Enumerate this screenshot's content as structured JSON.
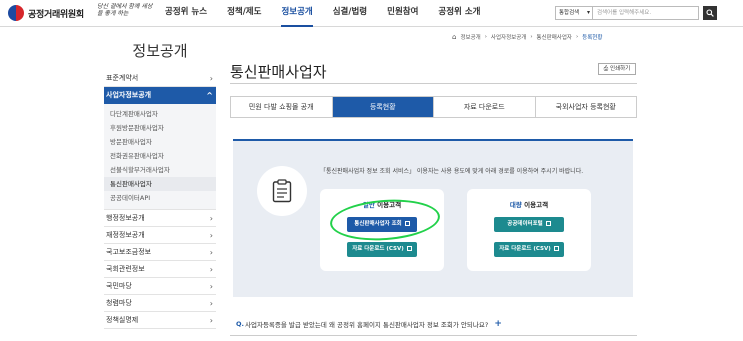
{
  "header": {
    "logo_text": "공정거래위원회",
    "slogan": "당신 곁에서 함께 세상을 좋게 하는",
    "nav": [
      "공정위 뉴스",
      "정책/제도",
      "정보공개",
      "심결/법령",
      "민원참여",
      "공정위 소개"
    ],
    "nav_active_index": 2,
    "search_select": "통합검색",
    "search_placeholder": "검색어를 입력해주세요."
  },
  "sidebar": {
    "title": "정보공개",
    "items_top": [
      {
        "label": "표준계약서",
        "arrow": "›"
      }
    ],
    "active_item": {
      "label": "사업자정보공개",
      "arrow": "^"
    },
    "sub_items": [
      "다단계판매사업자",
      "후원방문판매사업자",
      "방문판매사업자",
      "전화권유판매사업자",
      "선불식할부거래사업자",
      "통신판매사업자",
      "공공데이터API"
    ],
    "sub_active_index": 5,
    "items_bottom": [
      {
        "label": "행정정보공개",
        "arrow": "›"
      },
      {
        "label": "재정정보공개",
        "arrow": "›"
      },
      {
        "label": "국고보조금정보",
        "arrow": "›"
      },
      {
        "label": "국회관련정보",
        "arrow": "›"
      },
      {
        "label": "국민마당",
        "arrow": "›"
      },
      {
        "label": "청렴마당",
        "arrow": "›"
      },
      {
        "label": "정책실명제",
        "arrow": "›"
      }
    ]
  },
  "breadcrumb": [
    "정보공개",
    "사업자정보공개",
    "통신판매사업자",
    "등록현황"
  ],
  "page": {
    "title": "통신판매사업자",
    "print_label": "인쇄하기"
  },
  "tabs": [
    "민원 다발 쇼핑몰 공개",
    "등록현황",
    "자료 다운로드",
    "국외사업자 등록현황"
  ],
  "tab_active_index": 1,
  "panel": {
    "description": "「통신판매사업자 정보 조회 서비스」 이용자는 사용 용도에 맞게 아래 경로를 이용하여 주시기 바랍니다.",
    "general": {
      "title_hl": "일반",
      "title_rest": " 이용고객",
      "btn1": "통신판매사업자 조회",
      "btn2": "자료 다운로드 (CSV)"
    },
    "bulk": {
      "title_hl": "대량",
      "title_rest": " 이용고객",
      "btn1": "공공데이터포털",
      "btn2": "자료 다운로드 (CSV)"
    }
  },
  "faq": {
    "q": "Q.",
    "text": "사업자등록증을 발급 받았는데 왜 공정위 홈페이지 통신판매사업자 정보 조회가 안되나요?",
    "plus": "+"
  },
  "colors": {
    "primary": "#1e5aa8",
    "teal": "#1d8a8f",
    "highlight": "#22d14a"
  }
}
